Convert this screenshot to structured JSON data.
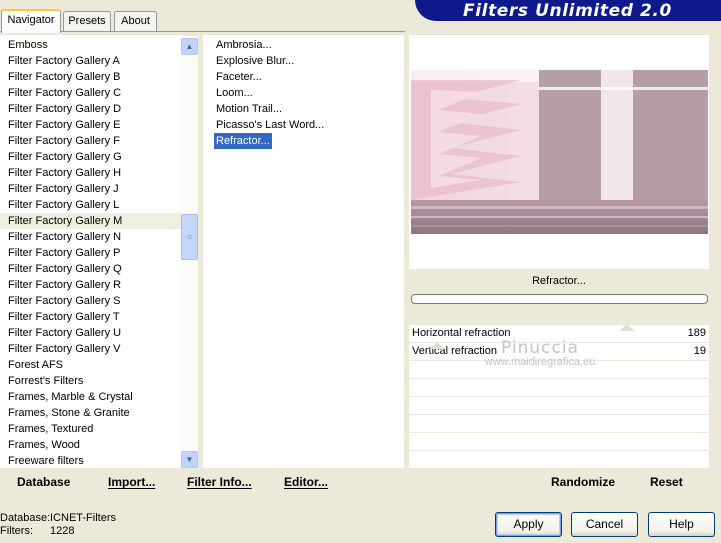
{
  "tabs": [
    {
      "label": "Navigator",
      "active": true
    },
    {
      "label": "Presets",
      "active": false
    },
    {
      "label": "About",
      "active": false
    }
  ],
  "banner_title": "Filters Unlimited 2.0",
  "categories": [
    "Emboss",
    "Filter Factory Gallery A",
    "Filter Factory Gallery B",
    "Filter Factory Gallery C",
    "Filter Factory Gallery D",
    "Filter Factory Gallery E",
    "Filter Factory Gallery F",
    "Filter Factory Gallery G",
    "Filter Factory Gallery H",
    "Filter Factory Gallery J",
    "Filter Factory Gallery L",
    "Filter Factory Gallery M",
    "Filter Factory Gallery N",
    "Filter Factory Gallery P",
    "Filter Factory Gallery Q",
    "Filter Factory Gallery R",
    "Filter Factory Gallery S",
    "Filter Factory Gallery T",
    "Filter Factory Gallery U",
    "Filter Factory Gallery V",
    "Forest AFS",
    "Forrest's Filters",
    "Frames, Marble & Crystal",
    "Frames, Stone & Granite",
    "Frames, Textured",
    "Frames, Wood",
    "Freeware filters"
  ],
  "selected_category": "Filter Factory Gallery M",
  "filters": [
    "Ambrosia...",
    "Explosive Blur...",
    "Faceter...",
    "Loom...",
    "Motion Trail...",
    "Picasso's Last Word...",
    "Refractor..."
  ],
  "selected_filter": "Refractor...",
  "preview": {
    "filter_name": "Refractor...",
    "progress": 0
  },
  "parameters": [
    {
      "label": "Horizontal refraction",
      "value": "189",
      "level": 0.74
    },
    {
      "label": "Vertical refraction",
      "value": "19",
      "level": 0.07
    }
  ],
  "watermark": {
    "name": "Pinuccia",
    "url": "www.maidiregrafica.eu"
  },
  "actions": {
    "database": "Database",
    "import": "Import...",
    "filter_info": "Filter Info...",
    "editor": "Editor...",
    "randomize": "Randomize",
    "reset": "Reset"
  },
  "status": {
    "database_label": "Database:",
    "database_value": "ICNET-Filters",
    "filters_label": "Filters:",
    "filters_value": "1228"
  },
  "buttons": {
    "apply": "Apply",
    "cancel": "Cancel",
    "help": "Help"
  },
  "colors": {
    "banner": "#0e1a8c",
    "selection": "#316ac5",
    "dialog_bg": "#ece9d8"
  }
}
